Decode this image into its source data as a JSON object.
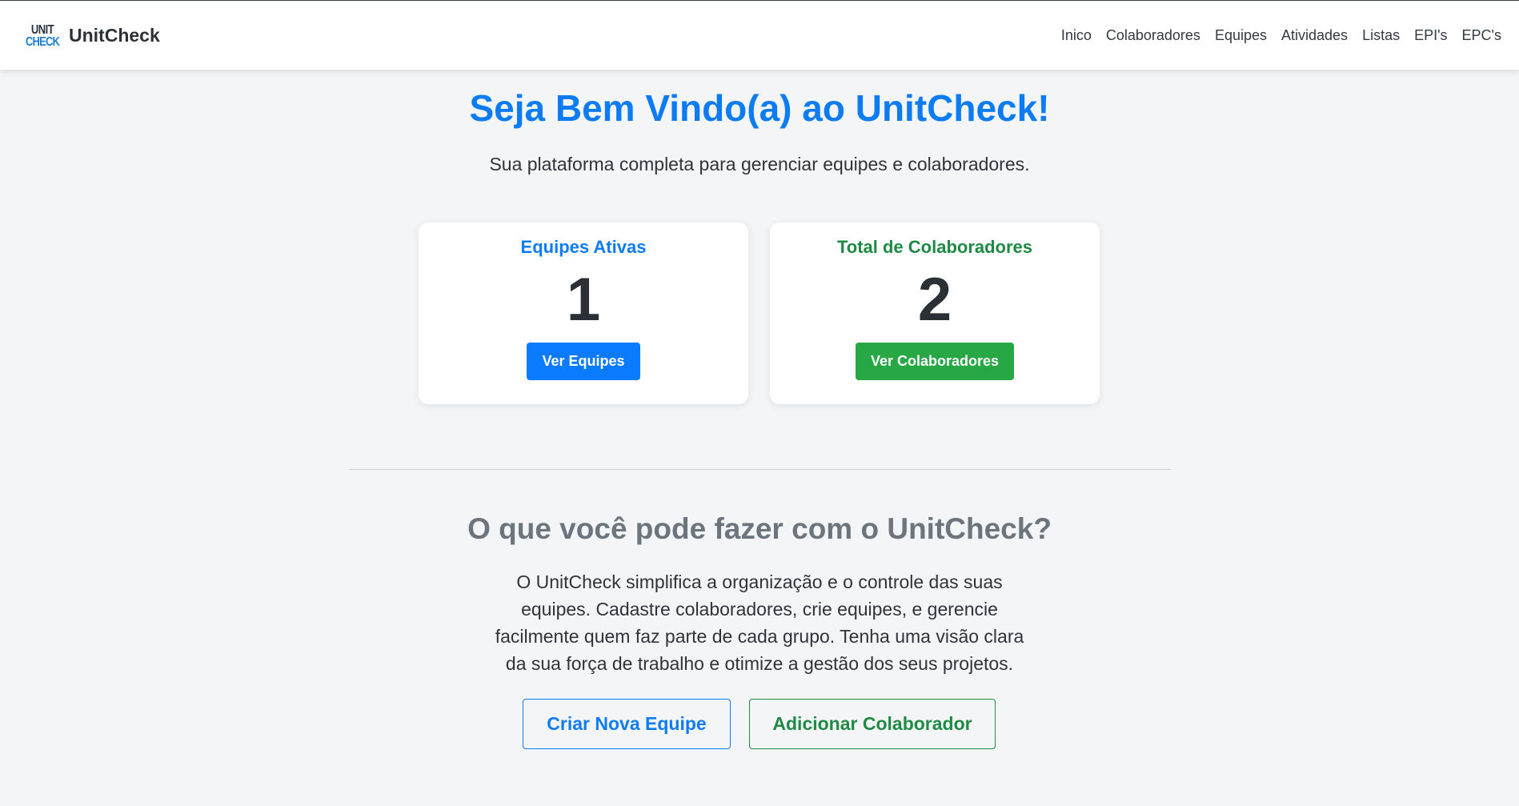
{
  "navbar": {
    "logo_top": "UNIT",
    "logo_bottom": "CHECK",
    "brand": "UnitCheck",
    "links": [
      "Inico",
      "Colaboradores",
      "Equipes",
      "Atividades",
      "Listas",
      "EPI's",
      "EPC's"
    ]
  },
  "hero": {
    "title": "Seja Bem Vindo(a) ao UnitCheck!",
    "subtitle": "Sua plataforma completa para gerenciar equipes e colaboradores."
  },
  "cards": [
    {
      "title": "Equipes Ativas",
      "value": "1",
      "button": "Ver Equipes"
    },
    {
      "title": "Total de Colaboradores",
      "value": "2",
      "button": "Ver Colaboradores"
    }
  ],
  "features": {
    "title": "O que você pode fazer com o UnitCheck?",
    "text": "O UnitCheck simplifica a organização e o controle das suas equipes. Cadastre colaboradores, crie equipes, e gerencie facilmente quem faz parte de cada grupo. Tenha uma visão clara da sua força de trabalho e otimize a gestão dos seus projetos.",
    "primary_button": "Criar Nova Equipe",
    "secondary_button": "Adicionar Colaborador"
  },
  "colors": {
    "primary": "#0d7cf2",
    "success": "#28a745",
    "success_text": "#1e8a44",
    "muted": "#6c757d"
  }
}
